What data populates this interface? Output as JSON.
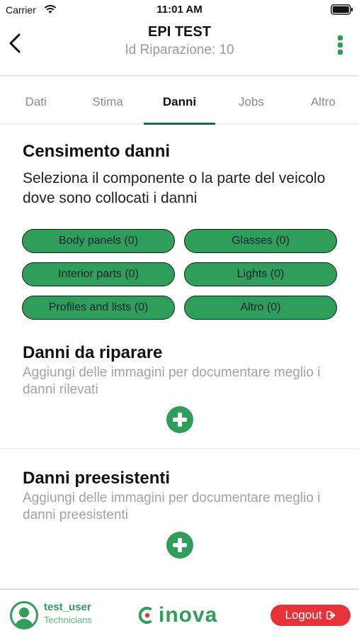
{
  "status_bar": {
    "carrier": "Carrier",
    "time": "11:01 AM"
  },
  "header": {
    "title": "EPI TEST",
    "subtitle": "Id Riparazione: 10"
  },
  "tabs": [
    {
      "label": "Dati",
      "active": false
    },
    {
      "label": "Stima",
      "active": false
    },
    {
      "label": "Danni",
      "active": true
    },
    {
      "label": "Jobs",
      "active": false
    },
    {
      "label": "Altro",
      "active": false
    }
  ],
  "census": {
    "title": "Censimento danni",
    "description": "Seleziona il componente o la parte del veicolo dove sono collocati i danni",
    "categories": [
      "Body panels (0)",
      "Glasses (0)",
      "Interior parts (0)",
      "Lights (0)",
      "Profiles and lists (0)",
      "Altro (0)"
    ]
  },
  "repair_damage": {
    "title": "Danni da riparare",
    "hint": "Aggiungi delle immagini per documentare meglio i danni rilevati"
  },
  "existing_damage": {
    "title": "Danni preesistenti",
    "hint": "Aggiungi delle immagini per documentare meglio i danni preesistenti"
  },
  "footer": {
    "user_name": "test_user",
    "user_role": "Technicians",
    "brand": "inova",
    "logout_label": "Logout"
  },
  "colors": {
    "accent": "#2f9e5a",
    "logout": "#e8323a"
  }
}
